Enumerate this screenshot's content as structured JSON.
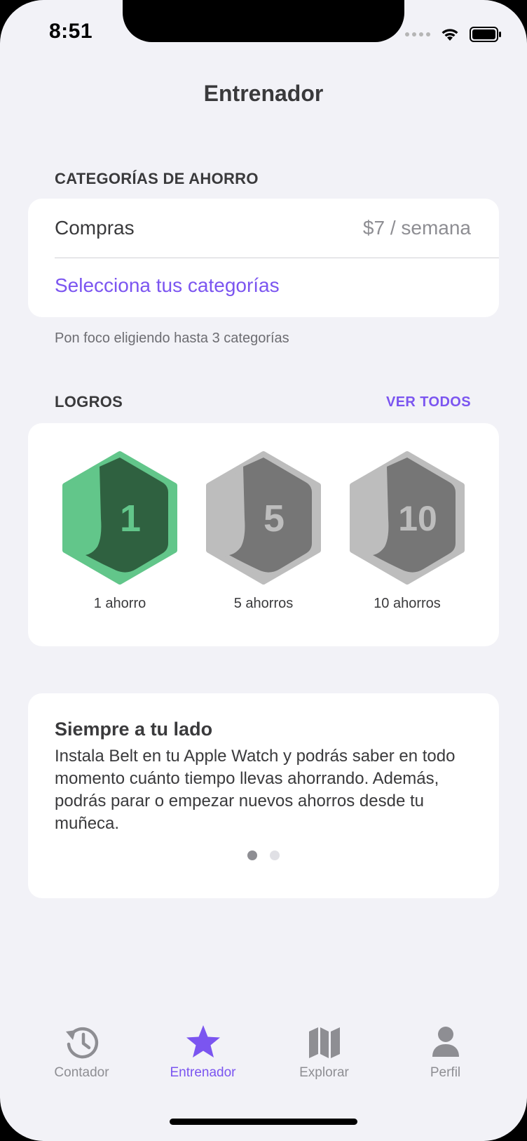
{
  "status_bar": {
    "time": "8:51"
  },
  "nav": {
    "title": "Entrenador"
  },
  "savings_categories": {
    "header": "CATEGORÍAS DE AHORRO",
    "item_name": "Compras",
    "item_value": "$7 / semana",
    "select_link": "Selecciona tus categorías",
    "footnote": "Pon foco eligiendo hasta 3 categorías"
  },
  "achievements": {
    "header": "LOGROS",
    "see_all": "VER TODOS",
    "badges": [
      {
        "number": "1",
        "label": "1 ahorro",
        "earned": true,
        "outer": "#62c68a",
        "inner": "#2f6140",
        "text": "#62c68a"
      },
      {
        "number": "5",
        "label": "5 ahorros",
        "earned": false,
        "outer": "#bdbdbd",
        "inner": "#767676",
        "text": "#bdbdbd"
      },
      {
        "number": "10",
        "label": "10 ahorros",
        "earned": false,
        "outer": "#bdbdbd",
        "inner": "#767676",
        "text": "#bdbdbd"
      }
    ]
  },
  "promo": {
    "title": "Siempre a tu lado",
    "body": "Instala Belt en tu Apple Watch y podrás saber en todo momento cuánto tiempo llevas ahorrando. Además, podrás parar o empezar nuevos ahorros desde tu muñeca.",
    "pages": 2,
    "current_page": 1
  },
  "tab_bar": {
    "tabs": [
      {
        "label": "Contador",
        "icon": "history-clock-icon",
        "active": false
      },
      {
        "label": "Entrenador",
        "icon": "star-icon",
        "active": true
      },
      {
        "label": "Explorar",
        "icon": "map-icon",
        "active": false
      },
      {
        "label": "Perfil",
        "icon": "person-icon",
        "active": false
      }
    ]
  },
  "colors": {
    "accent": "#7b55f0",
    "background": "#f2f2f7",
    "text": "#3a3a3c",
    "secondary_text": "#8e8e93"
  }
}
